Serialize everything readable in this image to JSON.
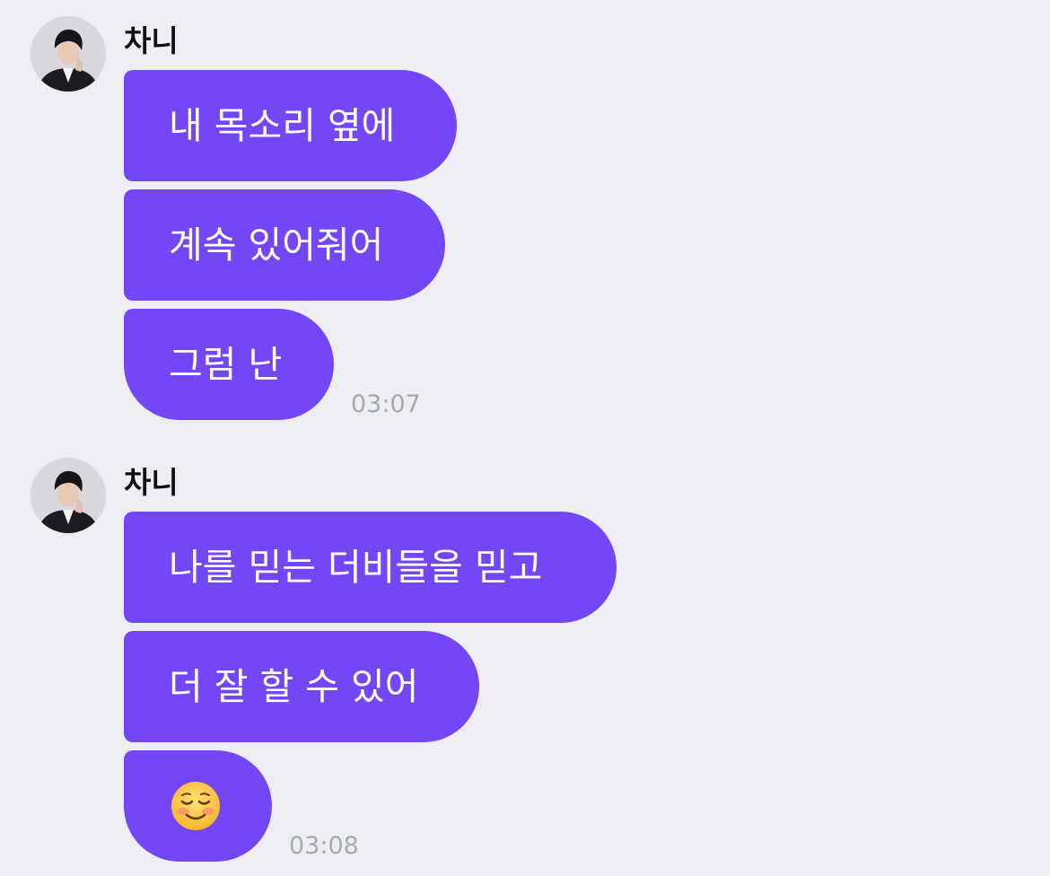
{
  "colors": {
    "background": "#EDEEF3",
    "bubble": "#7447F6",
    "bubble_text": "#FFFFFF",
    "timestamp": "#A7A9B0"
  },
  "groups": [
    {
      "sender": "차니",
      "avatar": "profile-photo",
      "messages": [
        {
          "text": "내 목소리 옆에"
        },
        {
          "text": "계속 있어줘어"
        },
        {
          "text": "그럼 난"
        }
      ],
      "time": "03:07"
    },
    {
      "sender": "차니",
      "avatar": "profile-photo",
      "messages": [
        {
          "text": "나를 믿는 더비들을 믿고"
        },
        {
          "text": "더 잘 할 수 있어"
        },
        {
          "emoji": "smiling-face-emoji"
        }
      ],
      "time": "03:08"
    }
  ]
}
